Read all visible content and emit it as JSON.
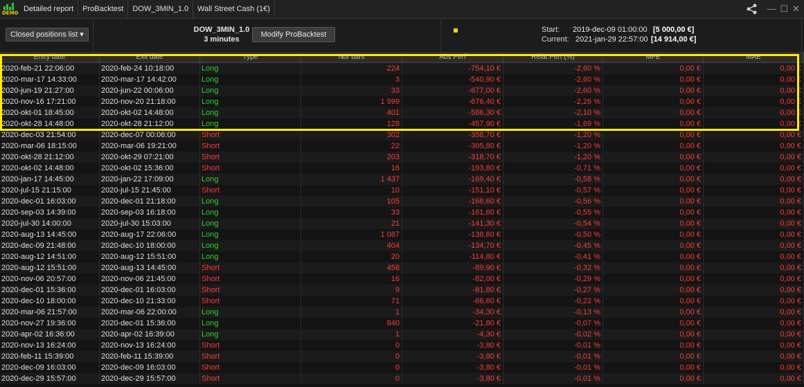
{
  "tabs": [
    "Detailed report",
    "ProBacktest",
    "DOW_3MIN_1.0",
    "Wall Street Cash (1€)"
  ],
  "logo_text": "DEMO",
  "toolbar": {
    "dropdown_label": "Closed positions list",
    "system_name": "DOW_3MIN_1.0",
    "timeframe": "3 minutes",
    "modify_label": "Modify ProBacktest",
    "start_label": "Start:",
    "start_date": "2019-dec-09 01:00:00",
    "start_capital": "[5 000,00 €]",
    "end_label": "Current:",
    "end_date": "2021-jan-29 22:57:00",
    "end_capital": "[14 914,00 €]"
  },
  "columns": [
    "Entry date",
    "Exit date",
    "Type",
    "Nbr bars",
    "Abs Perf",
    "Relat Perf (%)",
    "MFE",
    "MAE"
  ],
  "colors": {
    "long": "#2fd12f",
    "short": "#ff3b3b",
    "highlight": "#ffee00",
    "accent_dot": "#ffd400"
  },
  "rows": [
    {
      "entry": "2020-feb-21 22:06:00",
      "exit": "2020-feb-24 10:18:00",
      "type": "Long",
      "bars": "224",
      "abs": "-754,10 €",
      "rel": "-2,60 %",
      "mfe": "0,00 €",
      "mae": "0,00 €"
    },
    {
      "entry": "2020-mar-17 14:33:00",
      "exit": "2020-mar-17 14:42:00",
      "type": "Long",
      "bars": "3",
      "abs": "-540,90 €",
      "rel": "-2,60 %",
      "mfe": "0,00 €",
      "mae": "0,00 €"
    },
    {
      "entry": "2020-jun-19 21:27:00",
      "exit": "2020-jun-22 00:06:00",
      "type": "Long",
      "bars": "33",
      "abs": "-677,00 €",
      "rel": "-2,60 %",
      "mfe": "0,00 €",
      "mae": "0,00 €"
    },
    {
      "entry": "2020-nov-16 17:21:00",
      "exit": "2020-nov-20 21:18:00",
      "type": "Long",
      "bars": "1 999",
      "abs": "-676,40 €",
      "rel": "-2,26 %",
      "mfe": "0,00 €",
      "mae": "0,00 €"
    },
    {
      "entry": "2020-okt-01 18:45:00",
      "exit": "2020-okt-02 14:48:00",
      "type": "Long",
      "bars": "401",
      "abs": "-586,30 €",
      "rel": "-2,10 %",
      "mfe": "0,00 €",
      "mae": "0,00 €"
    },
    {
      "entry": "2020-okt-28 14:48:00",
      "exit": "2020-okt-28 21:12:00",
      "type": "Long",
      "bars": "128",
      "abs": "-457,90 €",
      "rel": "-1,69 %",
      "mfe": "0,00 €",
      "mae": "0,00 €"
    },
    {
      "entry": "2020-dec-03 21:54:00",
      "exit": "2020-dec-07 00:06:00",
      "type": "Short",
      "bars": "302",
      "abs": "-358,70 €",
      "rel": "-1,20 %",
      "mfe": "0,00 €",
      "mae": "0,00 €"
    },
    {
      "entry": "2020-mar-06 18:15:00",
      "exit": "2020-mar-06 19:21:00",
      "type": "Short",
      "bars": "22",
      "abs": "-305,80 €",
      "rel": "-1,20 %",
      "mfe": "0,00 €",
      "mae": "0,00 €"
    },
    {
      "entry": "2020-okt-28 21:12:00",
      "exit": "2020-okt-29 07:21:00",
      "type": "Short",
      "bars": "203",
      "abs": "-318,70 €",
      "rel": "-1,20 %",
      "mfe": "0,00 €",
      "mae": "0,00 €"
    },
    {
      "entry": "2020-okt-02 14:48:00",
      "exit": "2020-okt-02 15:36:00",
      "type": "Short",
      "bars": "16",
      "abs": "-193,80 €",
      "rel": "-0,71 %",
      "mfe": "0,00 €",
      "mae": "0,00 €"
    },
    {
      "entry": "2020-jan-17 14:45:00",
      "exit": "2020-jan-22 17:09:00",
      "type": "Long",
      "bars": "1 437",
      "abs": "-169,40 €",
      "rel": "-0,58 %",
      "mfe": "0,00 €",
      "mae": "0,00 €"
    },
    {
      "entry": "2020-jul-15 21:15:00",
      "exit": "2020-jul-15 21:45:00",
      "type": "Short",
      "bars": "10",
      "abs": "-151,10 €",
      "rel": "-0,57 %",
      "mfe": "0,00 €",
      "mae": "0,00 €"
    },
    {
      "entry": "2020-dec-01 16:03:00",
      "exit": "2020-dec-01 21:18:00",
      "type": "Long",
      "bars": "105",
      "abs": "-168,60 €",
      "rel": "-0,56 %",
      "mfe": "0,00 €",
      "mae": "0,00 €"
    },
    {
      "entry": "2020-sep-03 14:39:00",
      "exit": "2020-sep-03 16:18:00",
      "type": "Long",
      "bars": "33",
      "abs": "-161,60 €",
      "rel": "-0,55 %",
      "mfe": "0,00 €",
      "mae": "0,00 €"
    },
    {
      "entry": "2020-jul-30 14:00:00",
      "exit": "2020-jul-30 15:03:00",
      "type": "Long",
      "bars": "21",
      "abs": "-141,30 €",
      "rel": "-0,54 %",
      "mfe": "0,00 €",
      "mae": "0,00 €"
    },
    {
      "entry": "2020-aug-13 14:45:00",
      "exit": "2020-aug-17 22:06:00",
      "type": "Long",
      "bars": "1 087",
      "abs": "-138,60 €",
      "rel": "-0,50 %",
      "mfe": "0,00 €",
      "mae": "0,00 €"
    },
    {
      "entry": "2020-dec-09 21:48:00",
      "exit": "2020-dec-10 18:00:00",
      "type": "Long",
      "bars": "404",
      "abs": "-134,70 €",
      "rel": "-0,45 %",
      "mfe": "0,00 €",
      "mae": "0,00 €"
    },
    {
      "entry": "2020-aug-12 14:51:00",
      "exit": "2020-aug-12 15:51:00",
      "type": "Long",
      "bars": "20",
      "abs": "-114,80 €",
      "rel": "-0,41 %",
      "mfe": "0,00 €",
      "mae": "0,00 €"
    },
    {
      "entry": "2020-aug-12 15:51:00",
      "exit": "2020-aug-13 14:45:00",
      "type": "Short",
      "bars": "458",
      "abs": "-89,90 €",
      "rel": "-0,32 %",
      "mfe": "0,00 €",
      "mae": "0,00 €"
    },
    {
      "entry": "2020-nov-06 20:57:00",
      "exit": "2020-nov-06 21:45:00",
      "type": "Short",
      "bars": "16",
      "abs": "-82,00 €",
      "rel": "-0,29 %",
      "mfe": "0,00 €",
      "mae": "0,00 €"
    },
    {
      "entry": "2020-dec-01 15:36:00",
      "exit": "2020-dec-01 16:03:00",
      "type": "Short",
      "bars": "9",
      "abs": "-81,80 €",
      "rel": "-0,27 %",
      "mfe": "0,00 €",
      "mae": "0,00 €"
    },
    {
      "entry": "2020-dec-10 18:00:00",
      "exit": "2020-dec-10 21:33:00",
      "type": "Short",
      "bars": "71",
      "abs": "-66,60 €",
      "rel": "-0,22 %",
      "mfe": "0,00 €",
      "mae": "0,00 €"
    },
    {
      "entry": "2020-mar-06 21:57:00",
      "exit": "2020-mar-06 22:00:00",
      "type": "Long",
      "bars": "1",
      "abs": "-34,30 €",
      "rel": "-0,13 %",
      "mfe": "0,00 €",
      "mae": "0,00 €"
    },
    {
      "entry": "2020-nov-27 19:36:00",
      "exit": "2020-dec-01 15:36:00",
      "type": "Long",
      "bars": "840",
      "abs": "-21,80 €",
      "rel": "-0,07 %",
      "mfe": "0,00 €",
      "mae": "0,00 €"
    },
    {
      "entry": "2020-apr-02 16:36:00",
      "exit": "2020-apr-02 16:39:00",
      "type": "Long",
      "bars": "1",
      "abs": "-4,30 €",
      "rel": "-0,02 %",
      "mfe": "0,00 €",
      "mae": "0,00 €"
    },
    {
      "entry": "2020-nov-13 16:24:00",
      "exit": "2020-nov-13 16:24:00",
      "type": "Short",
      "bars": "0",
      "abs": "-3,80 €",
      "rel": "-0,01 %",
      "mfe": "0,00 €",
      "mae": "0,00 €"
    },
    {
      "entry": "2020-feb-11 15:39:00",
      "exit": "2020-feb-11 15:39:00",
      "type": "Short",
      "bars": "0",
      "abs": "-3,80 €",
      "rel": "-0,01 %",
      "mfe": "0,00 €",
      "mae": "0,00 €"
    },
    {
      "entry": "2020-dec-09 16:03:00",
      "exit": "2020-dec-09 16:03:00",
      "type": "Short",
      "bars": "0",
      "abs": "-3,80 €",
      "rel": "-0,01 %",
      "mfe": "0,00 €",
      "mae": "0,00 €"
    },
    {
      "entry": "2020-dec-29 15:57:00",
      "exit": "2020-dec-29 15:57:00",
      "type": "Short",
      "bars": "0",
      "abs": "-3,80 €",
      "rel": "-0,01 %",
      "mfe": "0,00 €",
      "mae": "0,00 €"
    }
  ]
}
